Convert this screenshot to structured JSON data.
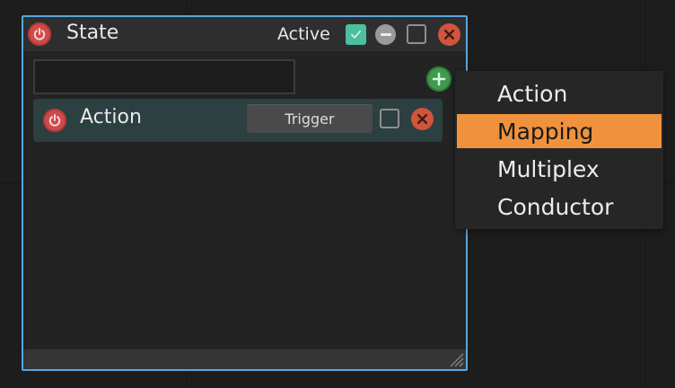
{
  "state_panel": {
    "title": "State",
    "active_label": "Active",
    "active_checked": true,
    "search": {
      "value": "",
      "placeholder": ""
    },
    "actions": [
      {
        "title": "Action",
        "trigger_label": "Trigger"
      }
    ]
  },
  "add_menu": {
    "items": [
      "Action",
      "Mapping",
      "Multiplex",
      "Conductor"
    ],
    "selected": "Mapping"
  },
  "colors": {
    "panel_border": "#5aa6dc",
    "power": "#d04a4a",
    "checkbox_checked": "#4bbf9f",
    "add": "#3f9a4c",
    "close": "#d0553c",
    "action_row": "#2c3f41",
    "menu_highlight": "#f0923d"
  },
  "icons": [
    "power-icon",
    "check-icon",
    "minus-icon",
    "close-icon",
    "plus-icon",
    "resize-grip-icon"
  ]
}
